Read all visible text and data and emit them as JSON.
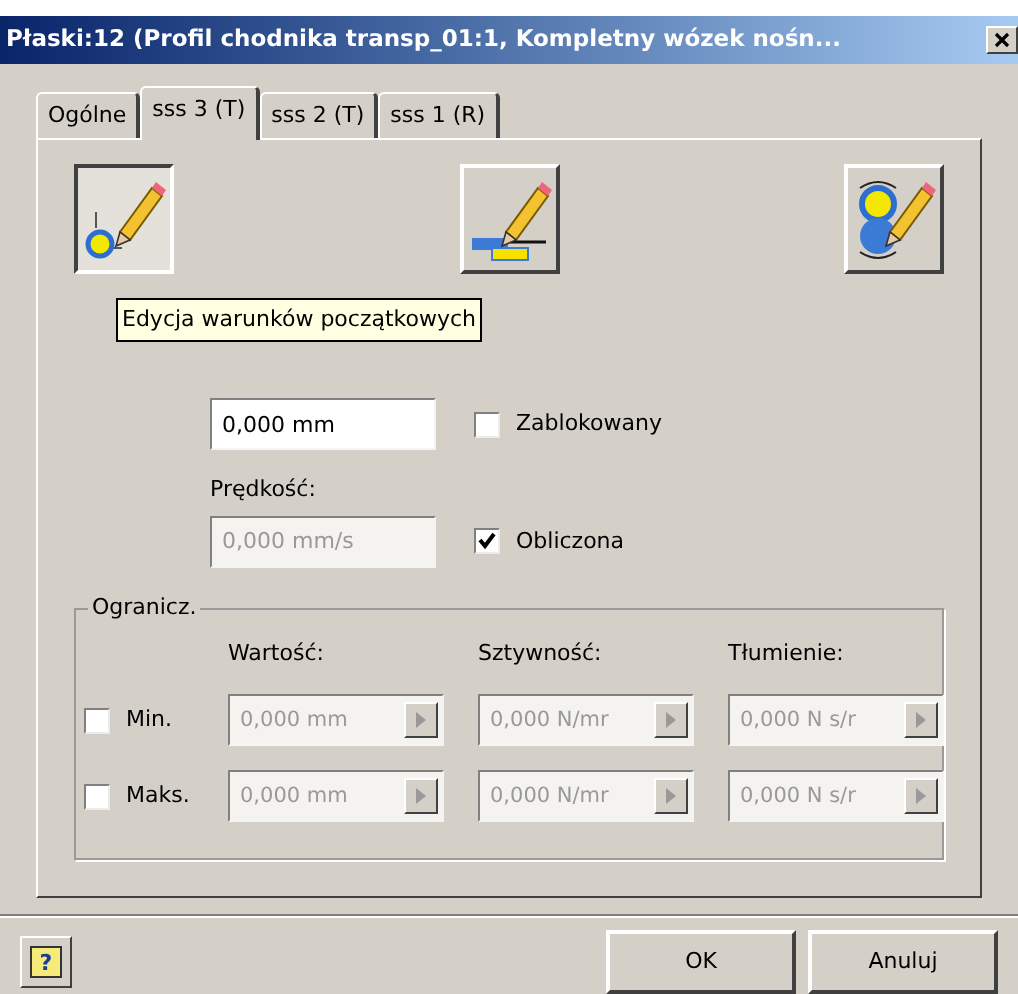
{
  "window": {
    "title": "Płaski:12 (Profil chodnika transp_01:1, Kompletny wózek nośn..."
  },
  "tabs": [
    {
      "label": "Ogólne",
      "selected": false
    },
    {
      "label": "sss 3 (T)",
      "selected": true
    },
    {
      "label": "sss 2 (T)",
      "selected": false
    },
    {
      "label": "sss 1 (R)",
      "selected": false
    }
  ],
  "tool_buttons": [
    {
      "kind": "initial",
      "pressed": true
    },
    {
      "kind": "edit",
      "pressed": false
    },
    {
      "kind": "swap",
      "pressed": false
    }
  ],
  "tooltip": "Edycja warunków początkowych",
  "position": {
    "value": "0,000 mm",
    "locked": {
      "label": "Zablokowany",
      "checked": false
    }
  },
  "velocity": {
    "label": "Prędkość:",
    "value": "0,000 mm/s",
    "disabled": true,
    "computed": {
      "label": "Obliczona",
      "checked": true
    }
  },
  "limits": {
    "title": "Ogranicz.",
    "columns": [
      "Wartość:",
      "Sztywność:",
      "Tłumienie:"
    ],
    "rows": [
      {
        "label": "Min.",
        "checked": false,
        "values": [
          "0,000 mm",
          "0,000 N/mr",
          "0,000 N s/r"
        ]
      },
      {
        "label": "Maks.",
        "checked": false,
        "values": [
          "0,000 mm",
          "0,000 N/mr",
          "0,000 N s/r"
        ]
      }
    ]
  },
  "help_button": "?",
  "buttons": [
    "OK",
    "Anuluj"
  ]
}
